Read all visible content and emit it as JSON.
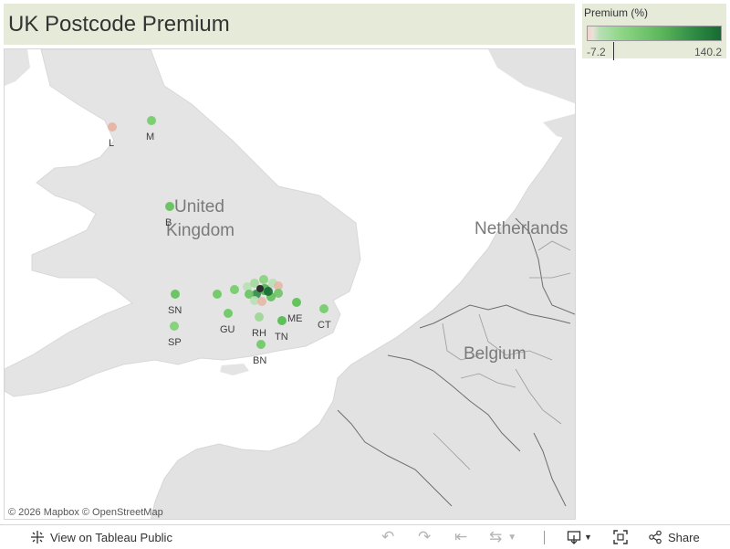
{
  "title": "UK Postcode Premium",
  "legend": {
    "title": "Premium (%)",
    "min_label": "-7.2",
    "max_label": "140.2",
    "min": -7.2,
    "max": 140.2,
    "marker_value": 0,
    "colors": {
      "negative": "#f2d3cd",
      "low": "#b7e0b3",
      "mid": "#5cb75b",
      "high": "#176b32"
    }
  },
  "map": {
    "countries": {
      "uk": "United Kingdom",
      "nl": "Netherlands",
      "be": "Belgium"
    },
    "attribution": "© 2026 Mapbox © OpenStreetMap",
    "postcodes": [
      {
        "code": "L",
        "color": "#e6b7a8"
      },
      {
        "code": "M",
        "color": "#7ccf72"
      },
      {
        "code": "B",
        "color": "#6cc464"
      },
      {
        "code": "SN",
        "color": "#6cc464"
      },
      {
        "code": "SP",
        "color": "#86d27d"
      },
      {
        "code": "GU",
        "color": "#74cb6c"
      },
      {
        "code": "RH",
        "color": "#a3d89b"
      },
      {
        "code": "BN",
        "color": "#78cc70"
      },
      {
        "code": "TN",
        "color": "#5fbf5a"
      },
      {
        "code": "ME",
        "color": "#66c45f"
      },
      {
        "code": "CT",
        "color": "#7ccf72"
      }
    ]
  },
  "toolbar": {
    "view_label": "View on Tableau Public",
    "share_label": "Share"
  },
  "icons": {
    "tableau": "tableau-logo-icon",
    "undo": "undo-icon",
    "redo": "redo-icon",
    "revert": "revert-icon",
    "refresh": "refresh-icon",
    "download": "download-icon",
    "fullscreen": "fullscreen-icon",
    "share": "share-icon"
  }
}
